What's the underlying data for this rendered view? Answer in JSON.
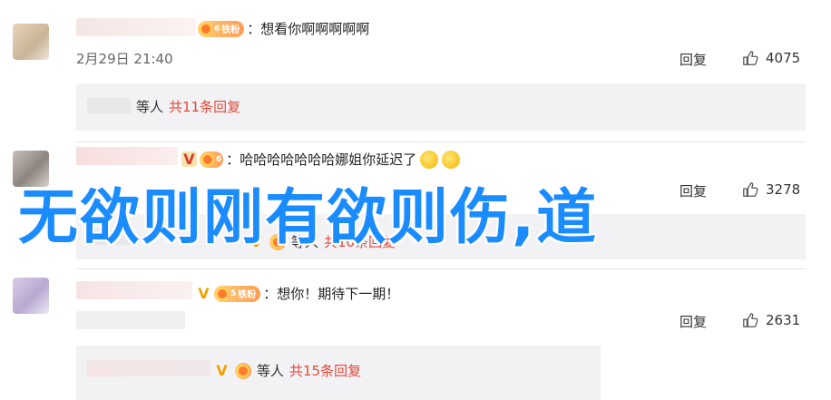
{
  "comments": [
    {
      "content": "：想看你啊啊啊啊啊",
      "fan_label": "铁粉",
      "fan_level": "6",
      "date": "2月29日 21:40",
      "reply_label": "回复",
      "likes": "4075",
      "thread": {
        "others": "等人",
        "total": "共11条回复"
      }
    },
    {
      "content": "：哈哈哈哈哈哈哈娜姐你延迟了",
      "fan_label": "",
      "fan_level": "6",
      "reply_label": "回复",
      "likes": "3278",
      "thread": {
        "others": "等人",
        "total": "共10条回复"
      }
    },
    {
      "content": "：想你！期待下一期！",
      "fan_label": "铁粉",
      "fan_level": "5",
      "reply_label": "回复",
      "likes": "2631",
      "thread": {
        "others": "等人",
        "total": "共15条回复"
      }
    }
  ],
  "overlay_text": "无欲则刚有欲则伤,道",
  "colors": {
    "link_red": "#e0493a",
    "overlay_blue": "#1a8cff",
    "reply_bg": "#f2f2f5"
  }
}
